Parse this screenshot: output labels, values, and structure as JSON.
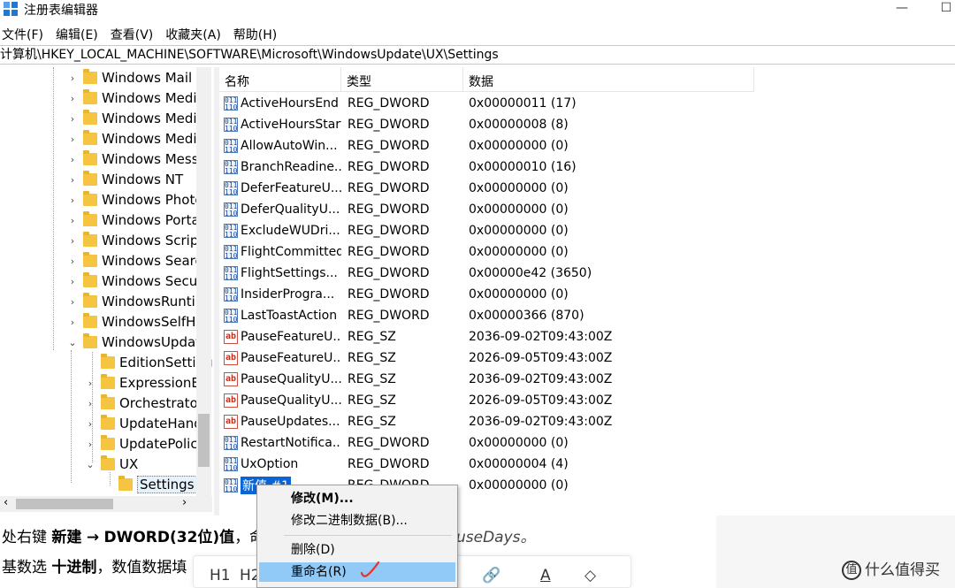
{
  "window": {
    "title": "注册表编辑器",
    "minimize_glyph": "—",
    "maximize_glyph": "☐"
  },
  "menu": [
    "文件(F)",
    "编辑(E)",
    "查看(V)",
    "收藏夹(A)",
    "帮助(H)"
  ],
  "address": "计算机\\HKEY_LOCAL_MACHINE\\SOFTWARE\\Microsoft\\WindowsUpdate\\UX\\Settings",
  "tree": {
    "items": [
      {
        "label": "Windows Mail",
        "expander": "›"
      },
      {
        "label": "Windows Media",
        "expander": "›"
      },
      {
        "label": "Windows Media",
        "expander": "›"
      },
      {
        "label": "Windows Media",
        "expander": "›"
      },
      {
        "label": "Windows Messa",
        "expander": "›"
      },
      {
        "label": "Windows NT",
        "expander": "›"
      },
      {
        "label": "Windows Photo",
        "expander": "›"
      },
      {
        "label": "Windows Portal",
        "expander": "›"
      },
      {
        "label": "Windows Script",
        "expander": "›"
      },
      {
        "label": "Windows Searcl",
        "expander": "›"
      },
      {
        "label": "Windows Securi",
        "expander": "›"
      },
      {
        "label": "WindowsRuntim",
        "expander": "›"
      },
      {
        "label": "WindowsSelfHo",
        "expander": "›"
      },
      {
        "label": "WindowsUpdate",
        "expander": "⌄"
      },
      {
        "label": "EditionSetting",
        "expander": ""
      },
      {
        "label": "ExpressionEv",
        "expander": "›"
      },
      {
        "label": "Orchestrator",
        "expander": "›"
      },
      {
        "label": "UpdateHand",
        "expander": "›"
      },
      {
        "label": "UpdatePolicy",
        "expander": "›"
      },
      {
        "label": "UX",
        "expander": "⌄"
      },
      {
        "label": "Settings",
        "expander": ""
      }
    ],
    "hscroll_left": "‹",
    "hscroll_right": "›"
  },
  "list": {
    "headers": {
      "name": "名称",
      "type": "类型",
      "data": "数据"
    },
    "rows": [
      {
        "icon": "dword",
        "name": "ActiveHoursEnd",
        "type": "REG_DWORD",
        "data": "0x00000011 (17)"
      },
      {
        "icon": "dword",
        "name": "ActiveHoursStart",
        "type": "REG_DWORD",
        "data": "0x00000008 (8)"
      },
      {
        "icon": "dword",
        "name": "AllowAutoWin...",
        "type": "REG_DWORD",
        "data": "0x00000000 (0)"
      },
      {
        "icon": "dword",
        "name": "BranchReadine...",
        "type": "REG_DWORD",
        "data": "0x00000010 (16)"
      },
      {
        "icon": "dword",
        "name": "DeferFeatureU...",
        "type": "REG_DWORD",
        "data": "0x00000000 (0)"
      },
      {
        "icon": "dword",
        "name": "DeferQualityU...",
        "type": "REG_DWORD",
        "data": "0x00000000 (0)"
      },
      {
        "icon": "dword",
        "name": "ExcludeWUDri...",
        "type": "REG_DWORD",
        "data": "0x00000000 (0)"
      },
      {
        "icon": "dword",
        "name": "FlightCommitted",
        "type": "REG_DWORD",
        "data": "0x00000000 (0)"
      },
      {
        "icon": "dword",
        "name": "FlightSettings...",
        "type": "REG_DWORD",
        "data": "0x00000e42 (3650)"
      },
      {
        "icon": "dword",
        "name": "InsiderProgra...",
        "type": "REG_DWORD",
        "data": "0x00000000 (0)"
      },
      {
        "icon": "dword",
        "name": "LastToastAction",
        "type": "REG_DWORD",
        "data": "0x00000366 (870)"
      },
      {
        "icon": "sz",
        "name": "PauseFeatureU...",
        "type": "REG_SZ",
        "data": "2036-09-02T09:43:00Z"
      },
      {
        "icon": "sz",
        "name": "PauseFeatureU...",
        "type": "REG_SZ",
        "data": "2026-09-05T09:43:00Z"
      },
      {
        "icon": "sz",
        "name": "PauseQualityU...",
        "type": "REG_SZ",
        "data": "2036-09-02T09:43:00Z"
      },
      {
        "icon": "sz",
        "name": "PauseQualityU...",
        "type": "REG_SZ",
        "data": "2026-09-05T09:43:00Z"
      },
      {
        "icon": "sz",
        "name": "PauseUpdates...",
        "type": "REG_SZ",
        "data": "2036-09-02T09:43:00Z"
      },
      {
        "icon": "dword",
        "name": "RestartNotifica...",
        "type": "REG_DWORD",
        "data": "0x00000000 (0)"
      },
      {
        "icon": "dword",
        "name": "UxOption",
        "type": "REG_DWORD",
        "data": "0x00000004 (4)"
      },
      {
        "icon": "dword",
        "name": "新值 #1",
        "type": "REG_DWORD",
        "data": "0x00000000 (0)"
      }
    ],
    "icon_glyphs": {
      "dword": "011\n110",
      "sz": "ab"
    }
  },
  "context_menu": {
    "modify": "修改(M)...",
    "modify_binary": "修改二进制数据(B)...",
    "delete": "删除(D)",
    "rename": "重命名(R)"
  },
  "background_doc": {
    "line1_prefix": "处右键",
    "line1_new": "新建",
    "line1_arrow": "→",
    "line1_dword": "DWORD(32位)值",
    "line1_mid": "，命",
    "line1_tail": "useDays。",
    "line2_prefix": "基数选",
    "line2_hex": "十进制",
    "line2_mid": "，数值数据填",
    "toolbar_h1": "H1",
    "toolbar_h2": "H2",
    "toolbar_link": "🔗",
    "toolbar_color": "A",
    "toolbar_fill": "◇",
    "logo": "什么值得买",
    "logo_mark": "值"
  },
  "colors": {
    "selection": "#0a64d4",
    "menu_highlight": "#91c9f7",
    "annotation": "#e8302a",
    "folder": "#f5c542"
  }
}
